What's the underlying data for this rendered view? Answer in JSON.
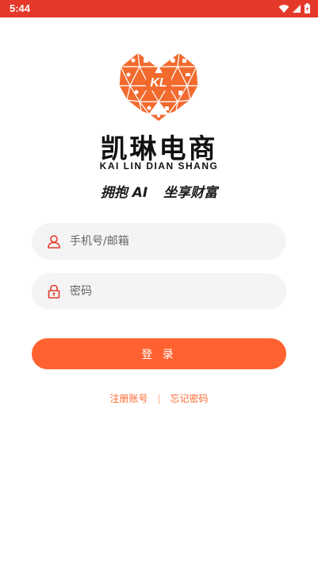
{
  "status_bar": {
    "time": "5:44"
  },
  "brand": {
    "title": "凯琳电商",
    "subtitle": "KAI LIN DIAN SHANG",
    "logo_text": "KL",
    "slogan_left": "拥抱 AI",
    "slogan_right": "坐享财富",
    "accent": "#ff6230"
  },
  "form": {
    "account_placeholder": "手机号/邮箱",
    "password_placeholder": "密码",
    "login_label": "登 录"
  },
  "links": {
    "register": "注册账号",
    "separator": "|",
    "forgot": "忘记密码"
  }
}
